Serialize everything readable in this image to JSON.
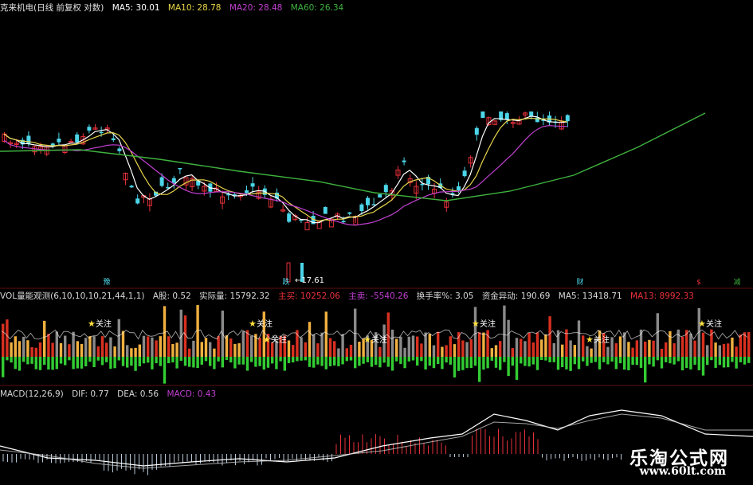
{
  "colors": {
    "bg": "#000000",
    "up": "#e8313a",
    "down": "#4cd5e8",
    "ma5": "#ffffff",
    "ma10": "#e8d54a",
    "ma20": "#c040d0",
    "ma60": "#3fb23f",
    "vol_yellow": "#f0b040",
    "vol_red": "#d83020",
    "vol_green": "#33cc33",
    "gray": "#8a8a8a"
  },
  "price_panel": {
    "title": "克来机电(日线 前复权 对数)",
    "ma5": "MA5: 30.01",
    "ma10": "MA10: 28.78",
    "ma20": "MA20: 28.48",
    "ma60": "MA60: 26.34",
    "low_note": "←17.61",
    "markers": [
      {
        "label": "豫",
        "color": "#4cd5e8"
      },
      {
        "label": "跌",
        "color": "#4cd5e8"
      },
      {
        "label": "财",
        "color": "#4cd5e8"
      },
      {
        "label": "$",
        "color": "#e8313a"
      },
      {
        "label": "减",
        "color": "#3fb23f"
      }
    ]
  },
  "volume_panel": {
    "title": "VOL量能观测(6,10,10,10,21,44,1,1)",
    "a_shares": "A股: 0.52",
    "actual": "实际量: 15792.32",
    "main_buy": "主买: 10252.06",
    "main_sell": "主卖: -5540.26",
    "turnover": "换手率%: 3.05",
    "abnormal": "资金异动: 190.69",
    "ma5": "MA5: 13418.71",
    "ma13": "MA13: 8992.33",
    "star_label": "关注"
  },
  "macd_panel": {
    "title": "MACD(12,26,9)",
    "dif": "DIF: 0.77",
    "dea": "DEA: 0.56",
    "macd": "MACD: 0.43"
  },
  "watermark": {
    "cn": "乐淘公式网",
    "url": "www.60lt.com"
  },
  "chart_data": {
    "type": "candlestick",
    "note_scale": "log",
    "price_low_label": 17.61,
    "macd": {
      "dif": 0.77,
      "dea": 0.56,
      "macd": 0.43
    }
  }
}
